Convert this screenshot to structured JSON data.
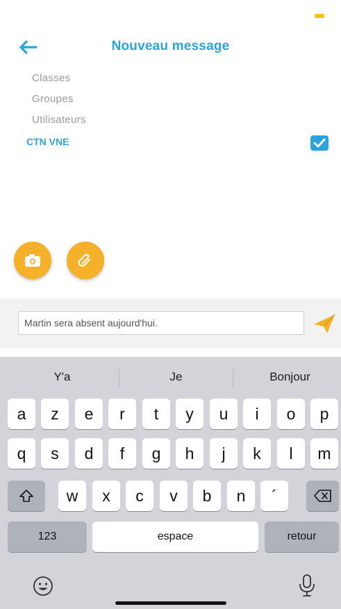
{
  "header": {
    "title": "Nouveau message"
  },
  "recipients": {
    "categories": [
      "Classes",
      "Groupes",
      "Utilisateurs"
    ],
    "selected": {
      "label": "CTN VNE",
      "checked": true
    }
  },
  "attachments": {
    "camera": "camera-icon",
    "attach": "paperclip-icon"
  },
  "compose": {
    "message": "Martin sera absent aujourd'hui.",
    "send": "send-icon"
  },
  "keyboard": {
    "suggestions": [
      "Y'a",
      "Je",
      "Bonjour"
    ],
    "row1": [
      "a",
      "z",
      "e",
      "r",
      "t",
      "y",
      "u",
      "i",
      "o",
      "p"
    ],
    "row2": [
      "q",
      "s",
      "d",
      "f",
      "g",
      "h",
      "j",
      "k",
      "l",
      "m"
    ],
    "row3": [
      "w",
      "x",
      "c",
      "v",
      "b",
      "n",
      "´"
    ],
    "numbers_key": "123",
    "space_key": "espace",
    "return_key": "retour"
  },
  "colors": {
    "accent": "#2ba3df",
    "button": "#f6b12a",
    "send": "#f6b12a"
  }
}
